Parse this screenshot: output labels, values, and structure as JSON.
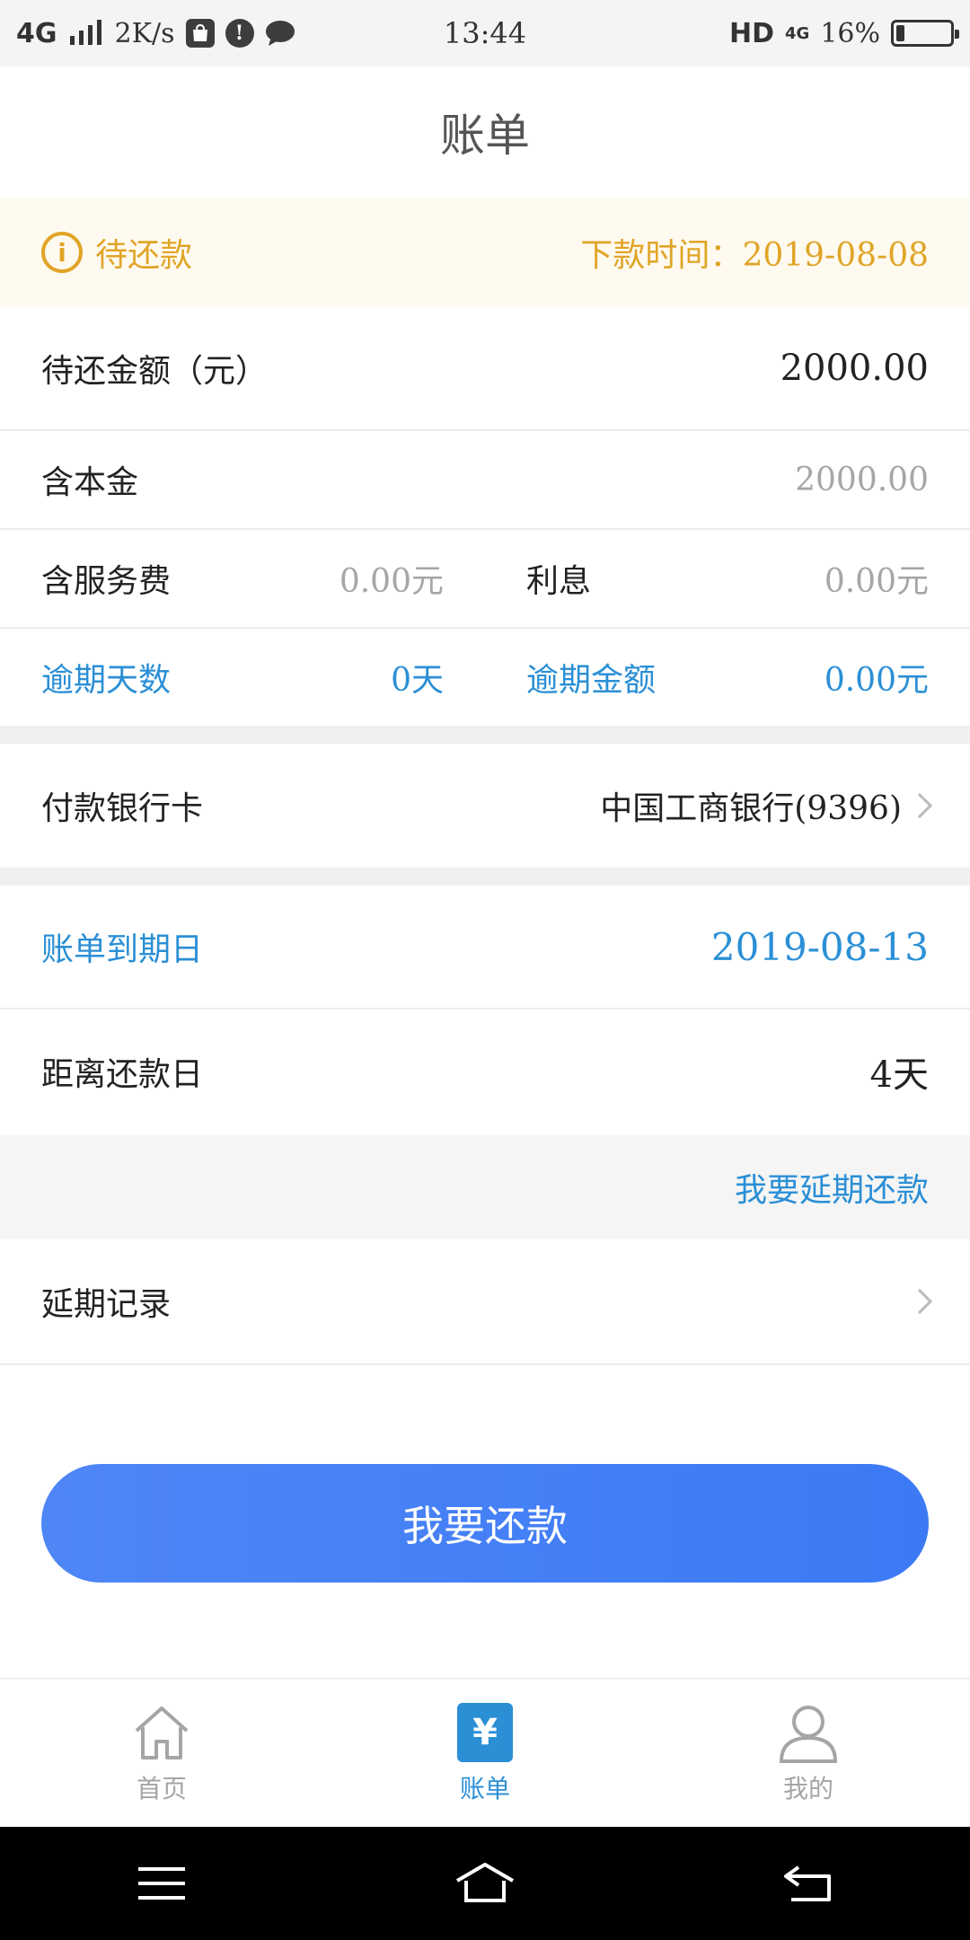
{
  "status_bar": {
    "network": "4G",
    "speed": "2K/s",
    "time": "13:44",
    "hd": "HD",
    "net_small": "4G",
    "battery": "16%",
    "battery_level": 0.16
  },
  "header": {
    "title": "账单"
  },
  "notice": {
    "status": "待还款",
    "disbursement_label": "下款时间：",
    "disbursement_date": "2019-08-08",
    "color": "#e0a528"
  },
  "bill": {
    "amount_label": "待还金额（元）",
    "amount_value": "2000.00",
    "principal_label": "含本金",
    "principal_value": "2000.00",
    "service_fee_label": "含服务费",
    "service_fee_value": "0.00元",
    "interest_label": "利息",
    "interest_value": "0.00元",
    "overdue_days_label": "逾期天数",
    "overdue_days_value": "0天",
    "overdue_amount_label": "逾期金额",
    "overdue_amount_value": "0.00元"
  },
  "payment_card": {
    "label": "付款银行卡",
    "value": "中国工商银行(9396)"
  },
  "due": {
    "label": "账单到期日",
    "date": "2019-08-13",
    "remaining_label": "距离还款日",
    "remaining_value": "4天"
  },
  "extend_link": "我要延期还款",
  "extension_record": {
    "label": "延期记录"
  },
  "pay_button": "我要还款",
  "tabs": [
    {
      "label": "首页",
      "icon": "home-icon"
    },
    {
      "label": "账单",
      "icon": "yen-icon",
      "icon_glyph": "¥"
    },
    {
      "label": "我的",
      "icon": "user-icon"
    }
  ],
  "colors": {
    "accent_blue": "#2b8fd6",
    "button_blue": "#4e86f6",
    "warning": "#e0a528"
  }
}
